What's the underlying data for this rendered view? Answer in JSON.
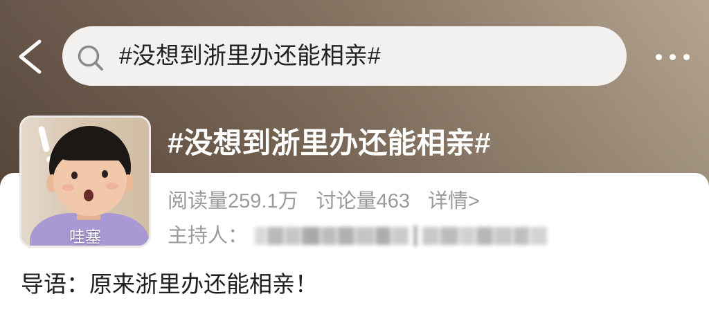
{
  "icons": {
    "back": "chevron-left-icon",
    "search": "search-icon",
    "more": "more-icon"
  },
  "theme": {
    "header_dark": "#5d4b3e",
    "header_mid": "#7e6a58",
    "header_light": "#b4a38d",
    "search_bg": "#f2f1f0",
    "search_text": "#222222",
    "meta_text": "#9b9b9b",
    "body_text": "#1f1f1f",
    "card_bg": "#ffffff"
  },
  "search": {
    "query": "#没想到浙里办还能相亲#"
  },
  "topic": {
    "avatar_caption": "哇塞",
    "title": "#没想到浙里办还能相亲#",
    "stats": [
      {
        "label": "阅读量",
        "value": "259.1万"
      },
      {
        "label": "讨论量",
        "value": "463"
      }
    ],
    "details_link": "详情>",
    "host_label": "主持人："
  },
  "intro": {
    "label": "导语：",
    "text": "原来浙里办还能相亲！"
  }
}
